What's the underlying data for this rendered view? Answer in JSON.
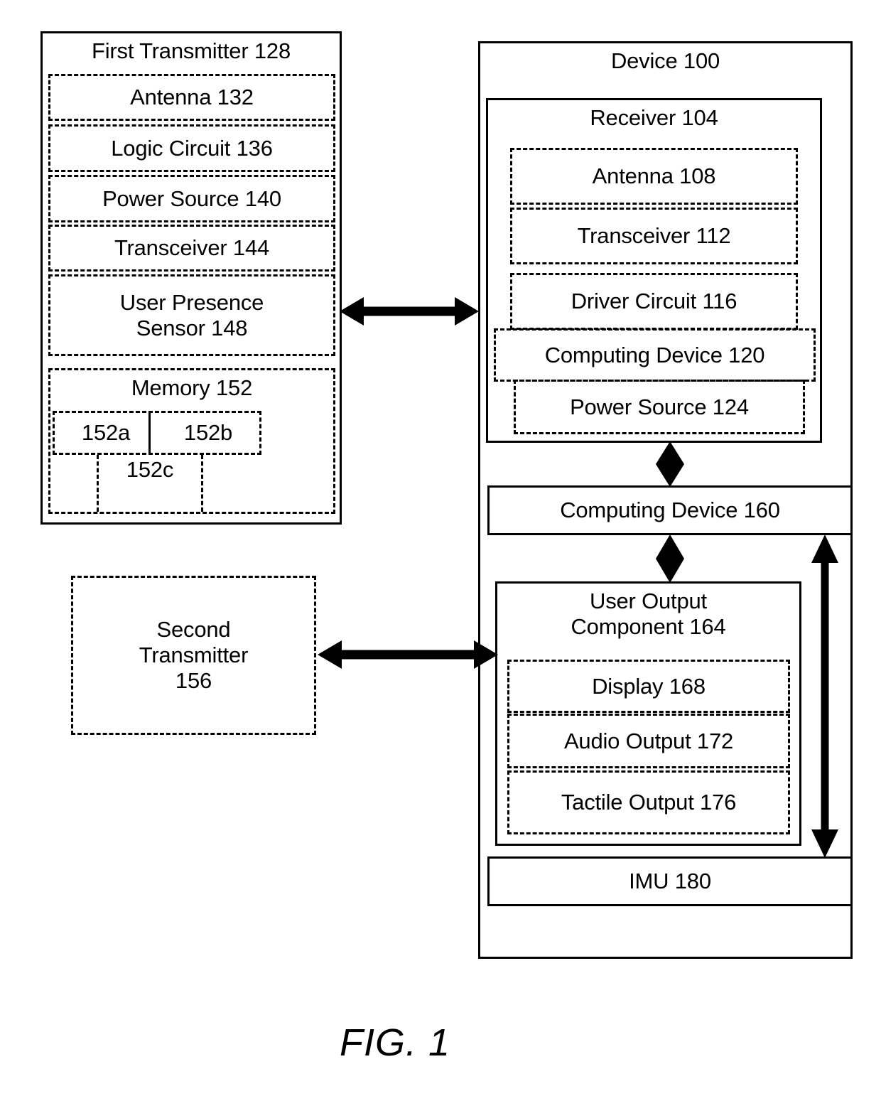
{
  "figure": {
    "caption": "FIG. 1",
    "stroke_color": "#000000",
    "background_color": "#ffffff"
  },
  "left_column": {
    "first_transmitter": {
      "title": "First Transmitter 128",
      "components": [
        {
          "label": "Antenna 132"
        },
        {
          "label": "Logic Circuit 136"
        },
        {
          "label": "Power Source 140"
        },
        {
          "label": "Transceiver 144"
        },
        {
          "label": "User Presence\nSensor 148"
        }
      ],
      "memory": {
        "title": "Memory 152",
        "partitions": [
          {
            "label": "152a"
          },
          {
            "label": "152b"
          },
          {
            "label": "152c"
          }
        ]
      }
    },
    "second_transmitter": {
      "label": "Second\nTransmitter\n156"
    }
  },
  "right_column": {
    "device": {
      "title": "Device 100",
      "receiver": {
        "title": "Receiver 104",
        "components": [
          {
            "label": "Antenna 108"
          },
          {
            "label": "Transceiver 112"
          },
          {
            "label": "Driver Circuit 116"
          },
          {
            "label": "Computing Device 120"
          },
          {
            "label": "Power Source 124"
          }
        ]
      },
      "computing_device": {
        "label": "Computing Device 160"
      },
      "user_output_component": {
        "title": "User Output\nComponent 164",
        "components": [
          {
            "label": "Display 168"
          },
          {
            "label": "Audio Output 172"
          },
          {
            "label": "Tactile Output 176"
          }
        ]
      },
      "imu": {
        "label": "IMU 180"
      }
    }
  },
  "connectors": [
    {
      "name": "first-transmitter-to-device",
      "type": "double-headed-horizontal"
    },
    {
      "name": "second-transmitter-to-user-output",
      "type": "double-headed-horizontal"
    },
    {
      "name": "receiver-to-computing-device-160",
      "type": "double-headed-vertical"
    },
    {
      "name": "computing-device-160-to-user-output",
      "type": "double-headed-vertical"
    },
    {
      "name": "computing-device-160-to-imu",
      "type": "double-headed-vertical"
    }
  ]
}
